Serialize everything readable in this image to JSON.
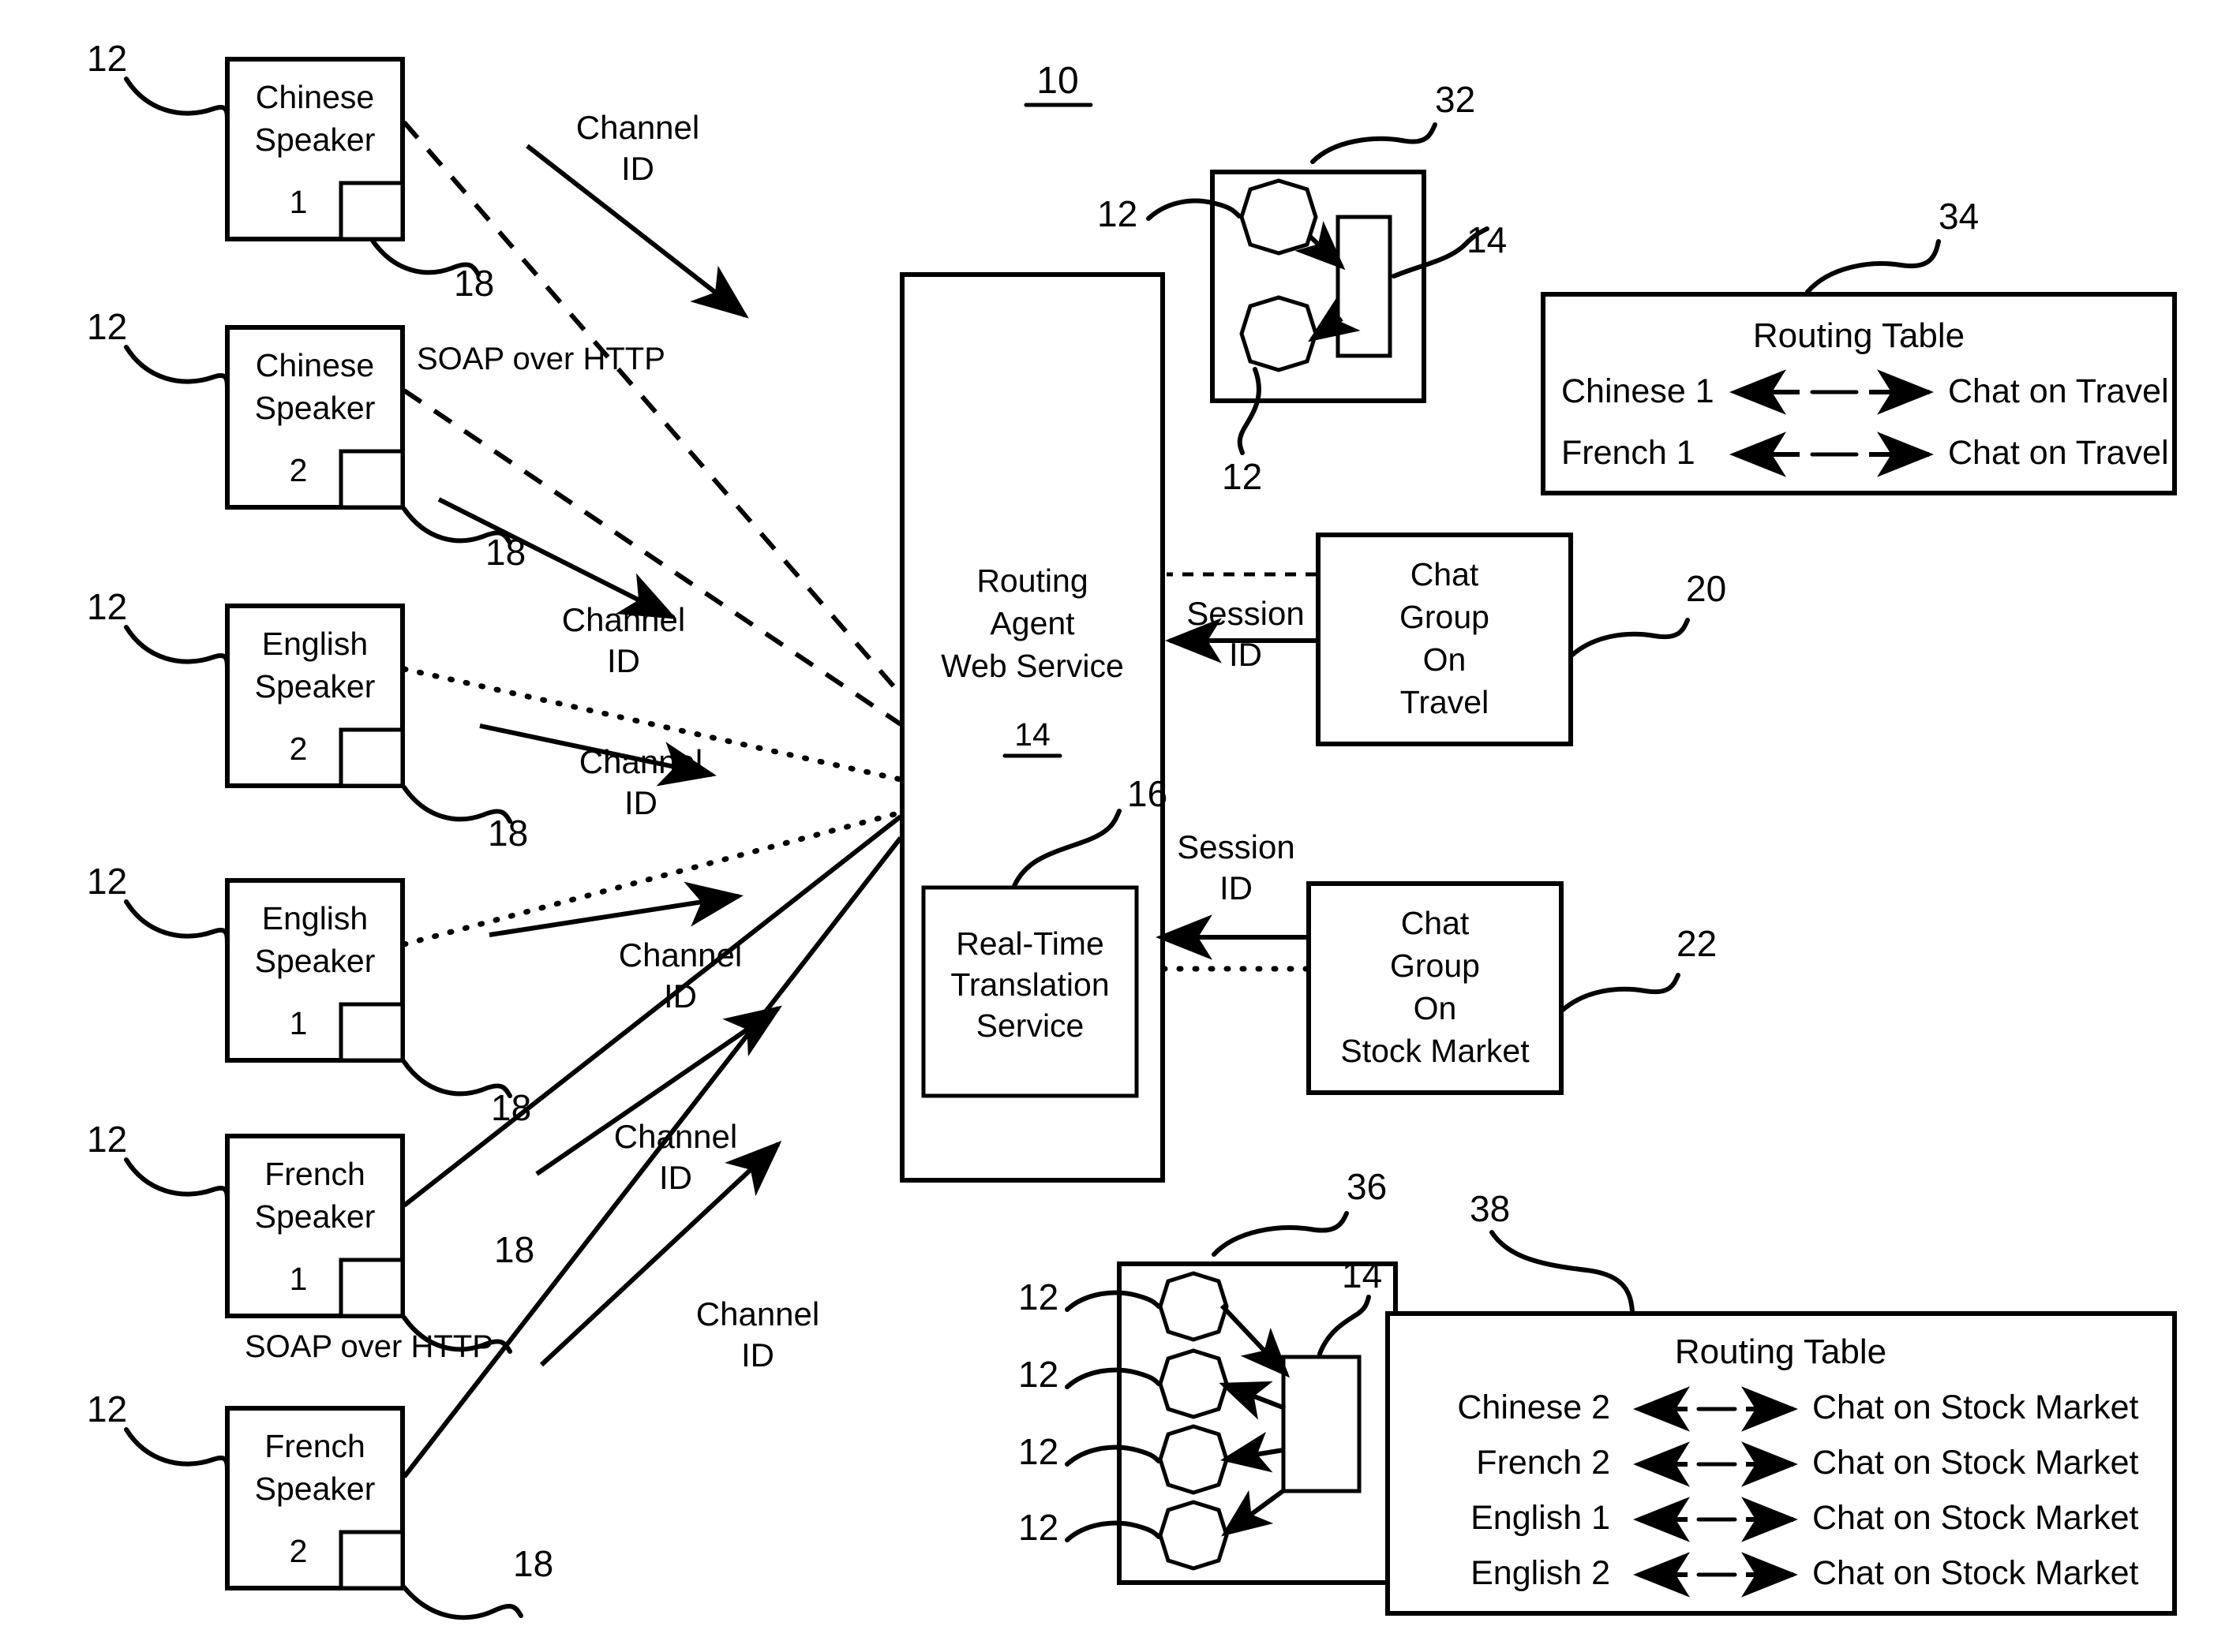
{
  "figure": {
    "number": "10",
    "title_visible": false
  },
  "speakers": [
    {
      "id": "chinese-speaker-1",
      "line1": "Chinese",
      "line2": "Speaker",
      "index": "1",
      "ref_node": "12",
      "ref_port": "18"
    },
    {
      "id": "chinese-speaker-2",
      "line1": "Chinese",
      "line2": "Speaker",
      "index": "2",
      "ref_node": "12",
      "ref_port": "18"
    },
    {
      "id": "english-speaker-2",
      "line1": "English",
      "line2": "Speaker",
      "index": "2",
      "ref_node": "12",
      "ref_port": "18"
    },
    {
      "id": "english-speaker-1",
      "line1": "English",
      "line2": "Speaker",
      "index": "1",
      "ref_node": "12",
      "ref_port": "18"
    },
    {
      "id": "french-speaker-1",
      "line1": "French",
      "line2": "Speaker",
      "index": "1",
      "ref_node": "12",
      "ref_port": "18"
    },
    {
      "id": "french-speaker-2",
      "line1": "French",
      "line2": "Speaker",
      "index": "2",
      "ref_node": "12",
      "ref_port": "18"
    }
  ],
  "routing_agent": {
    "line1": "Routing",
    "line2": "Agent",
    "line3": "Web Service",
    "ref": "14",
    "translation_service": {
      "line1": "Real-Time",
      "line2": "Translation",
      "line3": "Service",
      "ref": "16"
    }
  },
  "chat_groups": [
    {
      "id": "chat-group-travel",
      "lines": [
        "Chat",
        "Group",
        "On",
        "Travel"
      ],
      "ref": "20",
      "link_label_line1": "Session",
      "link_label_line2": "ID"
    },
    {
      "id": "chat-group-stock",
      "lines": [
        "Chat",
        "Group",
        "On",
        "Stock Market"
      ],
      "ref": "22",
      "link_label_line1": "Session",
      "link_label_line2": "ID"
    }
  ],
  "connection_labels": {
    "soap_top": "SOAP over HTTP",
    "soap_bottom": "SOAP over HTTP",
    "channel_id_line1": "Channel",
    "channel_id_line2": "ID"
  },
  "clusters": [
    {
      "id": "cluster-travel",
      "ref": "32",
      "node_ref": "12",
      "service_ref": "14",
      "node_count": 2
    },
    {
      "id": "cluster-stock",
      "ref": "36",
      "node_ref": "12",
      "service_ref": "14",
      "node_count": 4
    }
  ],
  "routing_tables": [
    {
      "id": "routing-table-travel",
      "ref": "34",
      "title": "Routing Table",
      "rows": [
        {
          "source": "Chinese 1",
          "target": "Chat on Travel"
        },
        {
          "source": "French 1",
          "target": "Chat on Travel"
        }
      ]
    },
    {
      "id": "routing-table-stock",
      "ref": "38",
      "title": "Routing Table",
      "rows": [
        {
          "source": "Chinese 2",
          "target": "Chat on Stock Market"
        },
        {
          "source": "French 2",
          "target": "Chat on Stock Market"
        },
        {
          "source": "English 1",
          "target": "Chat on Stock Market"
        },
        {
          "source": "English 2",
          "target": "Chat on Stock Market"
        }
      ]
    }
  ],
  "colors": {
    "ink": "#000000",
    "paper": "#ffffff"
  }
}
